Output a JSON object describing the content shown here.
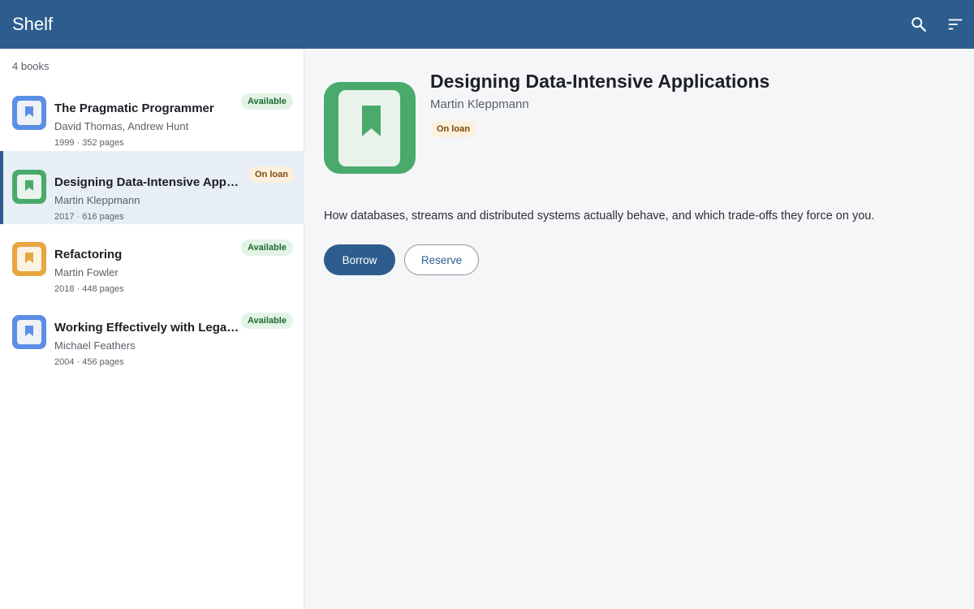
{
  "appbar": {
    "title": "Shelf",
    "icons": {
      "search": "search-icon",
      "sort": "sort-icon"
    }
  },
  "list": {
    "count_label": "4 books",
    "items": [
      {
        "title": "The Pragmatic Programmer",
        "author": "David Thomas, Andrew Hunt",
        "meta": "1999 · 352 pages",
        "status": "Available",
        "status_kind": "available",
        "cover_color": "#5b8ee6",
        "selected": false
      },
      {
        "title": "Designing Data-Intensive Applications",
        "author": "Martin Kleppmann",
        "meta": "2017 · 616 pages",
        "status": "On loan",
        "status_kind": "loan",
        "cover_color": "#4aaa6c",
        "selected": true
      },
      {
        "title": "Refactoring",
        "author": "Martin Fowler",
        "meta": "2018 · 448 pages",
        "status": "Available",
        "status_kind": "available",
        "cover_color": "#e8a640",
        "selected": false
      },
      {
        "title": "Working Effectively with Legacy Code",
        "author": "Michael Feathers",
        "meta": "2004 · 456 pages",
        "status": "Available",
        "status_kind": "available",
        "cover_color": "#5b8ee6",
        "selected": false
      }
    ]
  },
  "detail": {
    "title": "Designing Data-Intensive Applications",
    "author": "Martin Kleppmann",
    "status": "On loan",
    "cover_color": "#4aaa6c",
    "description": "How databases, streams and distributed systems actually behave, and which trade-offs they force on you.",
    "borrow_label": "Borrow",
    "reserve_label": "Reserve"
  },
  "colors": {
    "primary": "#2d5d8e",
    "available_bg": "#e3f3e6",
    "available_text": "#1d6b32",
    "loan_bg": "#fdf0dc",
    "loan_text": "#7a4a0c"
  }
}
